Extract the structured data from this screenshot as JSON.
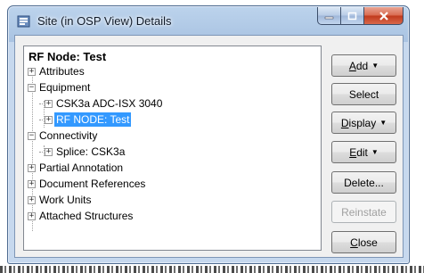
{
  "window": {
    "title": "Site (in OSP View) Details",
    "icon": "site-details-icon"
  },
  "tree": {
    "header": "RF Node: Test",
    "items": [
      {
        "label": "Attributes",
        "expander": "+",
        "level": 0
      },
      {
        "label": "Equipment",
        "expander": "−",
        "level": 0
      },
      {
        "label": "CSK3a ADC-ISX 3040",
        "expander": "+",
        "level": 1
      },
      {
        "label": "RF NODE: Test",
        "expander": "+",
        "level": 1,
        "selected": true
      },
      {
        "label": "Connectivity",
        "expander": "−",
        "level": 0
      },
      {
        "label": "Splice: CSK3a",
        "expander": "+",
        "level": 1
      },
      {
        "label": "Partial Annotation",
        "expander": "+",
        "level": 0
      },
      {
        "label": "Document References",
        "expander": "+",
        "level": 0
      },
      {
        "label": "Work Units",
        "expander": "+",
        "level": 0
      },
      {
        "label": "Attached Structures",
        "expander": "+",
        "level": 0
      }
    ]
  },
  "buttons": {
    "add": {
      "label": "Add",
      "mnemonic": "A",
      "rest": "dd",
      "arrow": "▼"
    },
    "select": {
      "label": "Select"
    },
    "display": {
      "label": "Display",
      "mnemonic": "D",
      "rest": "isplay",
      "arrow": "▼"
    },
    "edit": {
      "label": "Edit",
      "mnemonic": "E",
      "rest": "dit",
      "arrow": "▼"
    },
    "delete": {
      "label": "Delete..."
    },
    "reinstate": {
      "label": "Reinstate",
      "disabled": true
    },
    "close": {
      "label": "Close",
      "mnemonic": "C",
      "rest": "lose"
    }
  },
  "colors": {
    "selection": "#3399ff",
    "close_caption": "#c0391c"
  }
}
